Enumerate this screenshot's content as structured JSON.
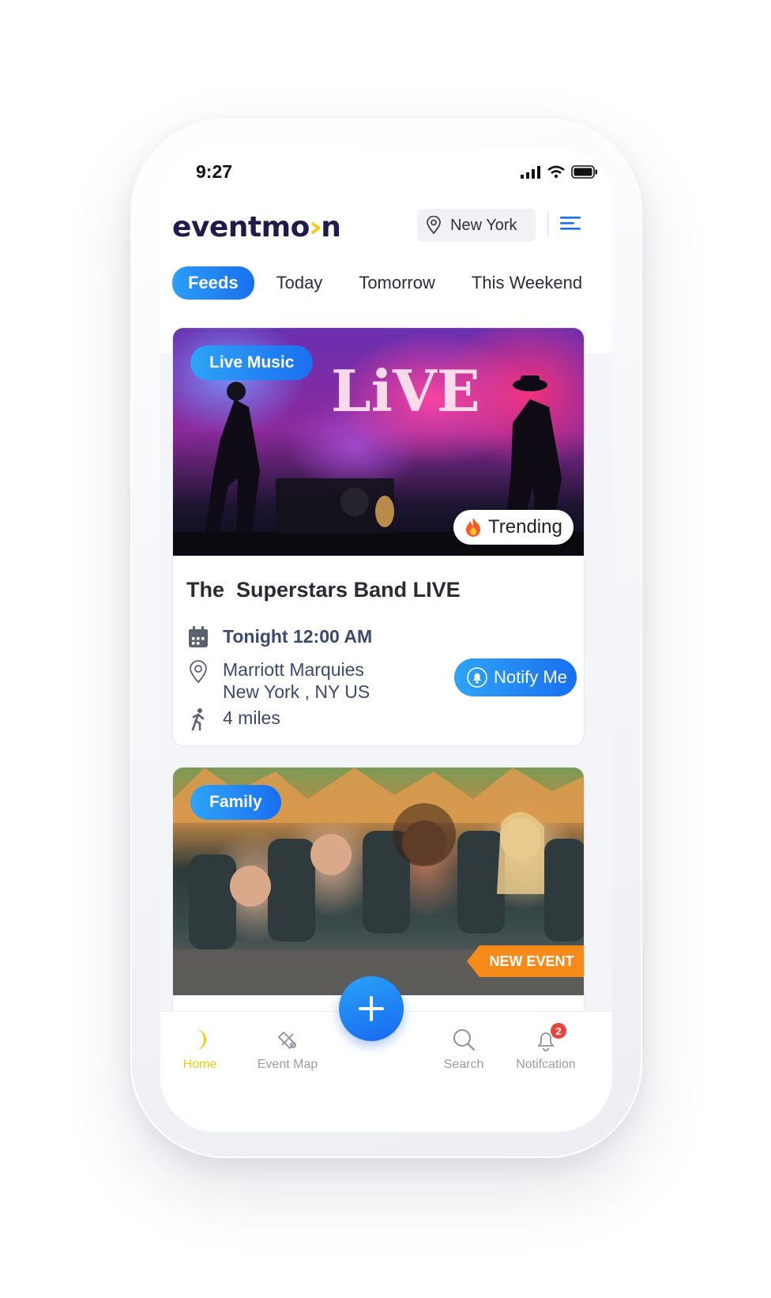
{
  "status_bar": {
    "time": "9:27"
  },
  "header": {
    "logo_prefix": "eventmo",
    "logo_moon": "›",
    "logo_suffix": "n",
    "location": "New York",
    "menu_icon": "menu-lines-icon"
  },
  "tabs": [
    {
      "label": "Feeds",
      "active": true
    },
    {
      "label": "Today",
      "active": false
    },
    {
      "label": "Tomorrow",
      "active": false
    },
    {
      "label": "This Weekend",
      "active": false
    }
  ],
  "feed": [
    {
      "category": "Live Music",
      "badge": "Trending",
      "title": "The  Superstars Band LIVE",
      "datetime": "Tonight 12:00 AM",
      "venue": "Marriott Marquies",
      "address": "New York , NY US",
      "distance": "4 miles",
      "action_label": "Notify Me"
    },
    {
      "category": "Family",
      "badge": "NEW EVENT"
    }
  ],
  "bottom_nav": [
    {
      "label": "Home",
      "icon": "moon-icon",
      "active": true
    },
    {
      "label": "Event Map",
      "icon": "map-pin-off-icon",
      "active": false
    },
    {
      "label": "Search",
      "icon": "search-icon",
      "active": false
    },
    {
      "label": "Notifcation",
      "icon": "bell-icon",
      "active": false,
      "badge": "2"
    }
  ],
  "colors": {
    "accent": "#1a6ff0",
    "brand_dark": "#1f1b4d",
    "moon": "#f6c90e",
    "new_event": "#f78b1a"
  }
}
